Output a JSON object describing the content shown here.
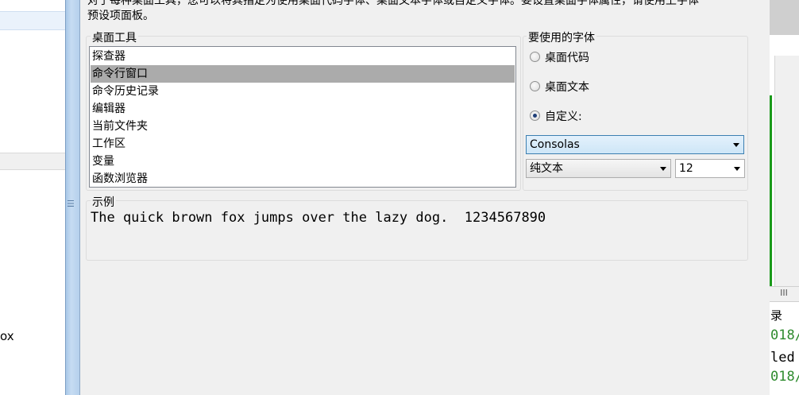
{
  "left_panel": {
    "partial_text": "ox"
  },
  "right_panel": {
    "label": "录",
    "lines": [
      "018/",
      "led",
      "018/"
    ],
    "scroll_label": "III"
  },
  "description": {
    "line1": "对于每种桌面工具，您可以将其指定为使用桌面代码字体、桌面文本字体或自定义字体。要设置桌面字体属性，请使用上字体",
    "line2": "预设项面板。"
  },
  "tools_group": {
    "label": "桌面工具",
    "items": [
      "探查器",
      "命令行窗口",
      "命令历史记录",
      "编辑器",
      "当前文件夹",
      "工作区",
      "变量",
      "函数浏览器"
    ],
    "selected_index": 1
  },
  "font_group": {
    "label": "要使用的字体",
    "options": [
      "桌面代码",
      "桌面文本",
      "自定义:"
    ],
    "selected_index": 2,
    "font_name": "Consolas",
    "style": "纯文本",
    "size": "12"
  },
  "sample_group": {
    "label": "示例",
    "text": "The quick brown fox jumps over the lazy dog.  1234567890"
  },
  "colors": {
    "selection": "#ababab",
    "dialog_bg": "#f0f0f0",
    "frame_blue": "#b5d0ec",
    "green_text": "#2e8b2e"
  }
}
